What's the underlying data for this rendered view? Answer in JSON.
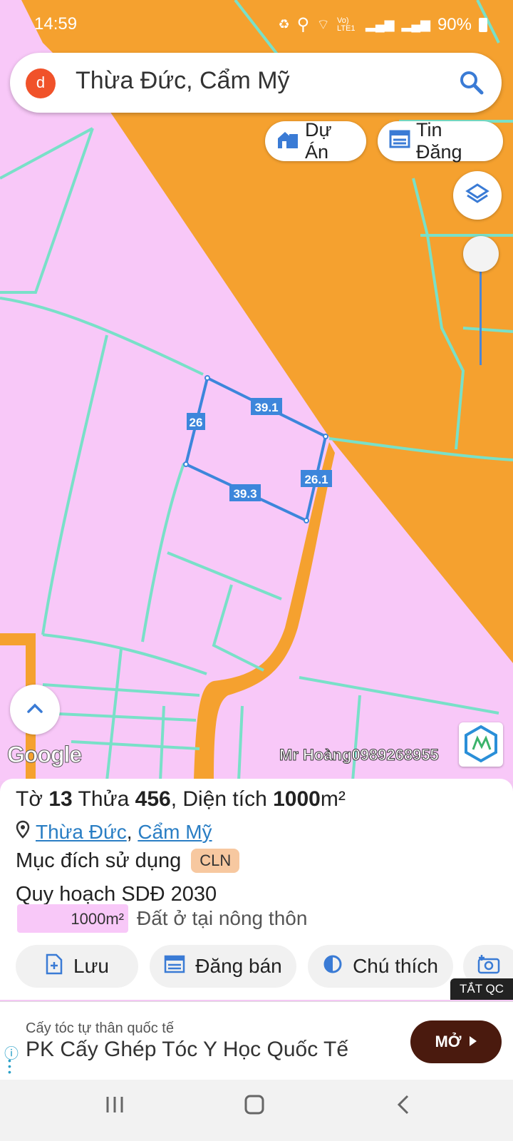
{
  "status": {
    "time": "14:59",
    "battery": "90%",
    "network": "Vo) LTE1"
  },
  "search": {
    "avatar_letter": "d",
    "query": "Thừa Đức, Cẩm Mỹ"
  },
  "chips": {
    "projects": "Dự Án",
    "listings": "Tin Đăng"
  },
  "map": {
    "edge_labels": [
      "39.1",
      "26",
      "26.1",
      "39.3"
    ],
    "google_label": "Google",
    "watermark": "Mr Hoàng0989268955",
    "colors": {
      "residential": "#f8c8f8",
      "road": "#f5a02e",
      "parcel_lines": "#79e0c8",
      "selection": "#3d86db"
    }
  },
  "info": {
    "sheet_label": "Tờ",
    "sheet_no": "13",
    "parcel_label": "Thửa",
    "parcel_no": "456",
    "area_label": ", Diện tích",
    "area_value": "1000",
    "area_unit": "m²",
    "ward": "Thừa Đức",
    "district": "Cẩm Mỹ",
    "separator": ",",
    "purpose_label": "Mục đích sử dụng",
    "purpose_code": "CLN",
    "plan_label": "Quy hoạch SDĐ 2030",
    "legend_area": "1000m²",
    "legend_desc": "Đất ở tại nông thôn"
  },
  "actions": {
    "save": "Lưu",
    "post": "Đăng bán",
    "legend": "Chú thích"
  },
  "ad": {
    "close_label": "TẮT QC",
    "subtitle": "Cấy tóc tự thân quốc tế",
    "title": "PK Cấy Ghép Tóc Y Học Quốc Tế",
    "cta": "MỞ"
  }
}
